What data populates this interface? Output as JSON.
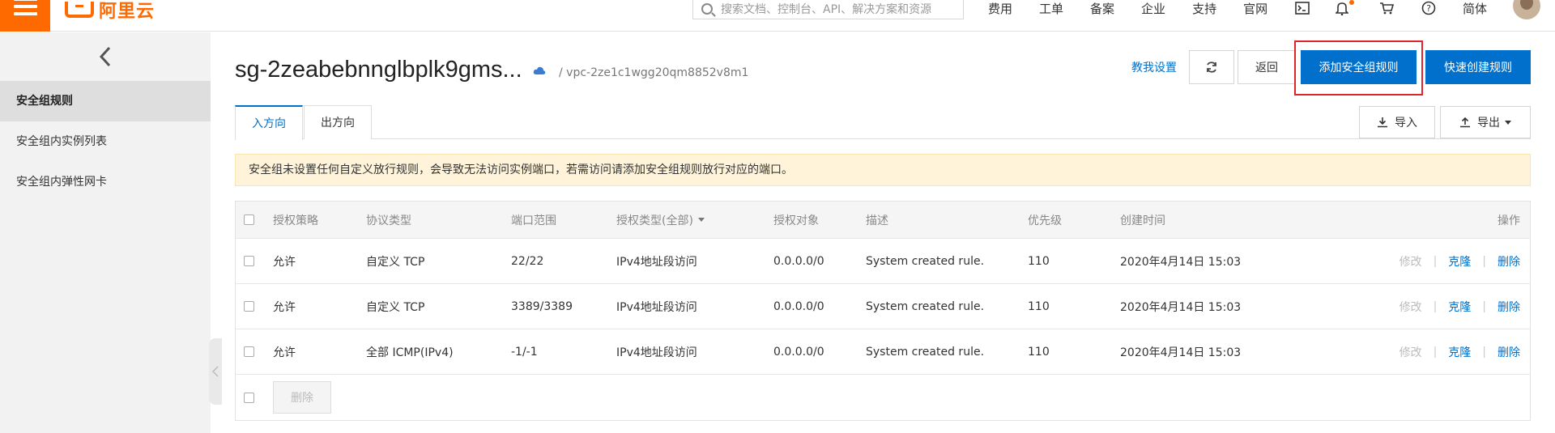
{
  "topbar": {
    "logo_text": "阿里云",
    "search_placeholder": "搜索文档、控制台、API、解决方案和资源",
    "links": [
      "费用",
      "工单",
      "备案",
      "企业",
      "支持",
      "官网"
    ],
    "lang": "简体",
    "brand_color": "#ff6a00"
  },
  "sidebar": {
    "items": [
      {
        "label": "安全组规则",
        "active": true
      },
      {
        "label": "安全组内实例列表",
        "active": false
      },
      {
        "label": "安全组内弹性网卡",
        "active": false
      }
    ]
  },
  "header": {
    "title": "sg-2zeabebnnglbplk9gms...",
    "vpc": "/ vpc-2ze1c1wgg20qm8852v8m1",
    "help_link": "教我设置",
    "back_label": "返回",
    "add_rule_label": "添加安全组规则",
    "quick_create_label": "快速创建规则",
    "import_label": "导入",
    "export_label": "导出"
  },
  "tabs": [
    "入方向",
    "出方向"
  ],
  "warning": "安全组未设置任何自定义放行规则，会导致无法访问实例端口，若需访问请添加安全组规则放行对应的端口。",
  "table": {
    "columns": [
      "授权策略",
      "协议类型",
      "端口范围",
      "授权类型(全部)",
      "授权对象",
      "描述",
      "优先级",
      "创建时间",
      "操作"
    ],
    "rows": [
      {
        "policy": "允许",
        "protocol": "自定义 TCP",
        "port": "22/22",
        "auth_type": "IPv4地址段访问",
        "target": "0.0.0.0/0",
        "desc": "System created rule.",
        "priority": "110",
        "created": "2020年4月14日 15:03"
      },
      {
        "policy": "允许",
        "protocol": "自定义 TCP",
        "port": "3389/3389",
        "auth_type": "IPv4地址段访问",
        "target": "0.0.0.0/0",
        "desc": "System created rule.",
        "priority": "110",
        "created": "2020年4月14日 15:03"
      },
      {
        "policy": "允许",
        "protocol": "全部 ICMP(IPv4)",
        "port": "-1/-1",
        "auth_type": "IPv4地址段访问",
        "target": "0.0.0.0/0",
        "desc": "System created rule.",
        "priority": "110",
        "created": "2020年4月14日 15:03"
      }
    ],
    "actions": {
      "edit": "修改",
      "clone": "克隆",
      "delete": "删除"
    },
    "bulk_delete_label": "删除"
  },
  "colors": {
    "accent": "#0070cc",
    "highlight_box": "#e0242b",
    "warning_bg": "#fff4d9"
  }
}
